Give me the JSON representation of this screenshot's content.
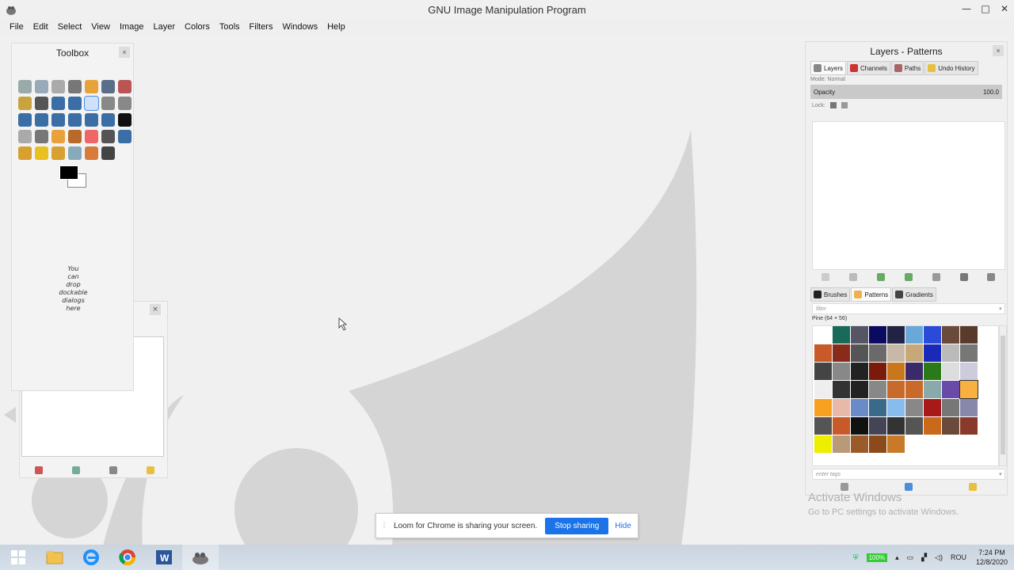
{
  "window": {
    "title": "GNU Image Manipulation Program",
    "controls": [
      "—",
      "□",
      "✕"
    ]
  },
  "menu": [
    "File",
    "Edit",
    "Select",
    "View",
    "Image",
    "Layer",
    "Colors",
    "Tools",
    "Filters",
    "Windows",
    "Help"
  ],
  "toolbox": {
    "title": "Toolbox",
    "close": "×",
    "drop_hint": [
      "You",
      "can",
      "drop",
      "dockable",
      "dialogs",
      "here"
    ],
    "tool_colors": [
      "#9aa",
      "#9ab",
      "#aaa",
      "#777",
      "#e8a23a",
      "#5a6e8a",
      "#b55",
      "#c8a440",
      "#555",
      "#3a6ea5",
      "#3a6ea5",
      "#3a6ea5",
      "#888",
      "#888",
      "#3a6ea5",
      "#3a6ea5",
      "#3a6ea5",
      "#3a6ea5",
      "#3a6ea5",
      "#3a6ea5",
      "#111",
      "#aaa",
      "#777",
      "#e8a23a",
      "#b86a2a",
      "#e66",
      "#555",
      "#3a6ea5",
      "#d8a030",
      "#e8c020",
      "#d8a030",
      "#8ab",
      "#d87a3a",
      "#444"
    ],
    "active_tool_index": 11
  },
  "dock2": {
    "close": "×"
  },
  "right_panel": {
    "title": "Layers - Patterns",
    "close": "×",
    "tabs": [
      {
        "label": "Layers",
        "color": "#888"
      },
      {
        "label": "Channels",
        "color": "#c33"
      },
      {
        "label": "Paths",
        "color": "#a66"
      },
      {
        "label": "Undo History",
        "color": "#e8c040"
      }
    ],
    "mode_label": "Mode: Normal",
    "opacity_label": "Opacity",
    "opacity_value": "100.0",
    "lock_label": "Lock:",
    "bottom_tabs": [
      {
        "label": "Brushes",
        "color": "#222"
      },
      {
        "label": "Patterns",
        "color": "#f0b050"
      },
      {
        "label": "Gradients",
        "color": "#444"
      }
    ],
    "filter_placeholder": "filter",
    "pattern_name": "Pine (64 × 56)",
    "tags_placeholder": "enter tags",
    "patterns": [
      "#fff",
      "#1a6a5a",
      "#556",
      "#0a0a60",
      "#224",
      "#6aa8d8",
      "#2a4ad8",
      "#6a4a3a",
      "#5a3a2a",
      "#c85a2a",
      "#8a2a1a",
      "#555",
      "#6a6a6a",
      "#c8b8a8",
      "#c8a878",
      "#1a2ab8",
      "#bbb",
      "#777",
      "#444",
      "#888",
      "#222",
      "#7a1a0a",
      "#c8781a",
      "#3a2a6a",
      "#2a7a1a",
      "#ddd",
      "#ccd",
      "#eee",
      "#333",
      "#222",
      "#888",
      "#c86a2a",
      "#c86a2a",
      "#8aa",
      "#6a4aa8",
      "#f8b040",
      "#f8a020",
      "#e8b8a8",
      "#6a8ac8",
      "#3a6a8a",
      "#88bbee",
      "#888",
      "#a81a1a",
      "#777",
      "#88a",
      "#555",
      "#c85a2a",
      "#111",
      "#445",
      "#333",
      "#555",
      "#c86a1a",
      "#6a4a3a",
      "#8a3a2a",
      "#ee0",
      "#b89a78",
      "#9a5a2a",
      "#8a4a1a",
      "#c87a2a"
    ]
  },
  "watermark": {
    "line1": "Activate Windows",
    "line2": "Go to PC settings to activate Windows."
  },
  "loom": {
    "message": "Loom for Chrome is sharing your screen.",
    "stop": "Stop sharing",
    "hide": "Hide"
  },
  "taskbar": {
    "battery": "100%",
    "lang": "ROU",
    "time": "7:24 PM",
    "date": "12/8/2020"
  }
}
